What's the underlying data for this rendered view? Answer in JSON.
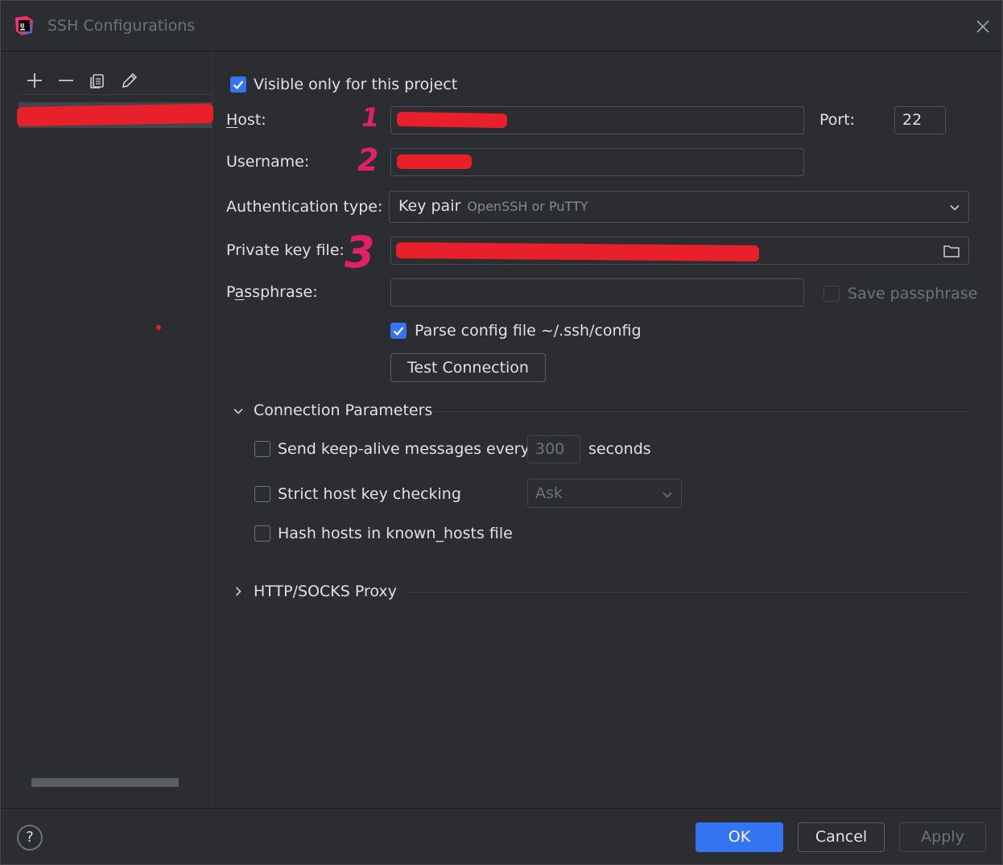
{
  "window": {
    "title": "SSH Configurations"
  },
  "sidebar": {
    "toolbar": {
      "add": "add-icon",
      "remove": "remove-icon",
      "copy": "copy-icon",
      "edit": "edit-icon"
    }
  },
  "form": {
    "visible_only_label": "Visible only for this project",
    "visible_only_checked": true,
    "host_label": "Host:",
    "host_mnemonic": "H",
    "port_label": "Port:",
    "port_value": "22",
    "username_label": "Username:",
    "auth_label": "Authentication type:",
    "auth_value_main": "Key pair",
    "auth_value_hint": "OpenSSH or PuTTY",
    "private_key_label": "Private key file:",
    "passphrase_label": "Passphrase:",
    "save_passphrase_label": "Save passphrase",
    "parse_config_label": "Parse config file ~/.ssh/config",
    "parse_config_checked": true,
    "test_connection_label": "Test Connection"
  },
  "annotations": [
    "1",
    "2",
    "3"
  ],
  "connection_parameters": {
    "title": "Connection Parameters",
    "keep_alive_label": "Send keep-alive messages every",
    "keep_alive_value": "300",
    "keep_alive_unit": "seconds",
    "strict_host_label": "Strict host key checking",
    "strict_host_value": "Ask",
    "hash_hosts_label": "Hash hosts in known_hosts file"
  },
  "proxy": {
    "title": "HTTP/SOCKS Proxy"
  },
  "footer": {
    "help": "?",
    "ok": "OK",
    "cancel": "Cancel",
    "apply": "Apply"
  },
  "colors": {
    "accent": "#3574f0",
    "redaction": "#e8202c",
    "annotation": "#e0216a"
  }
}
